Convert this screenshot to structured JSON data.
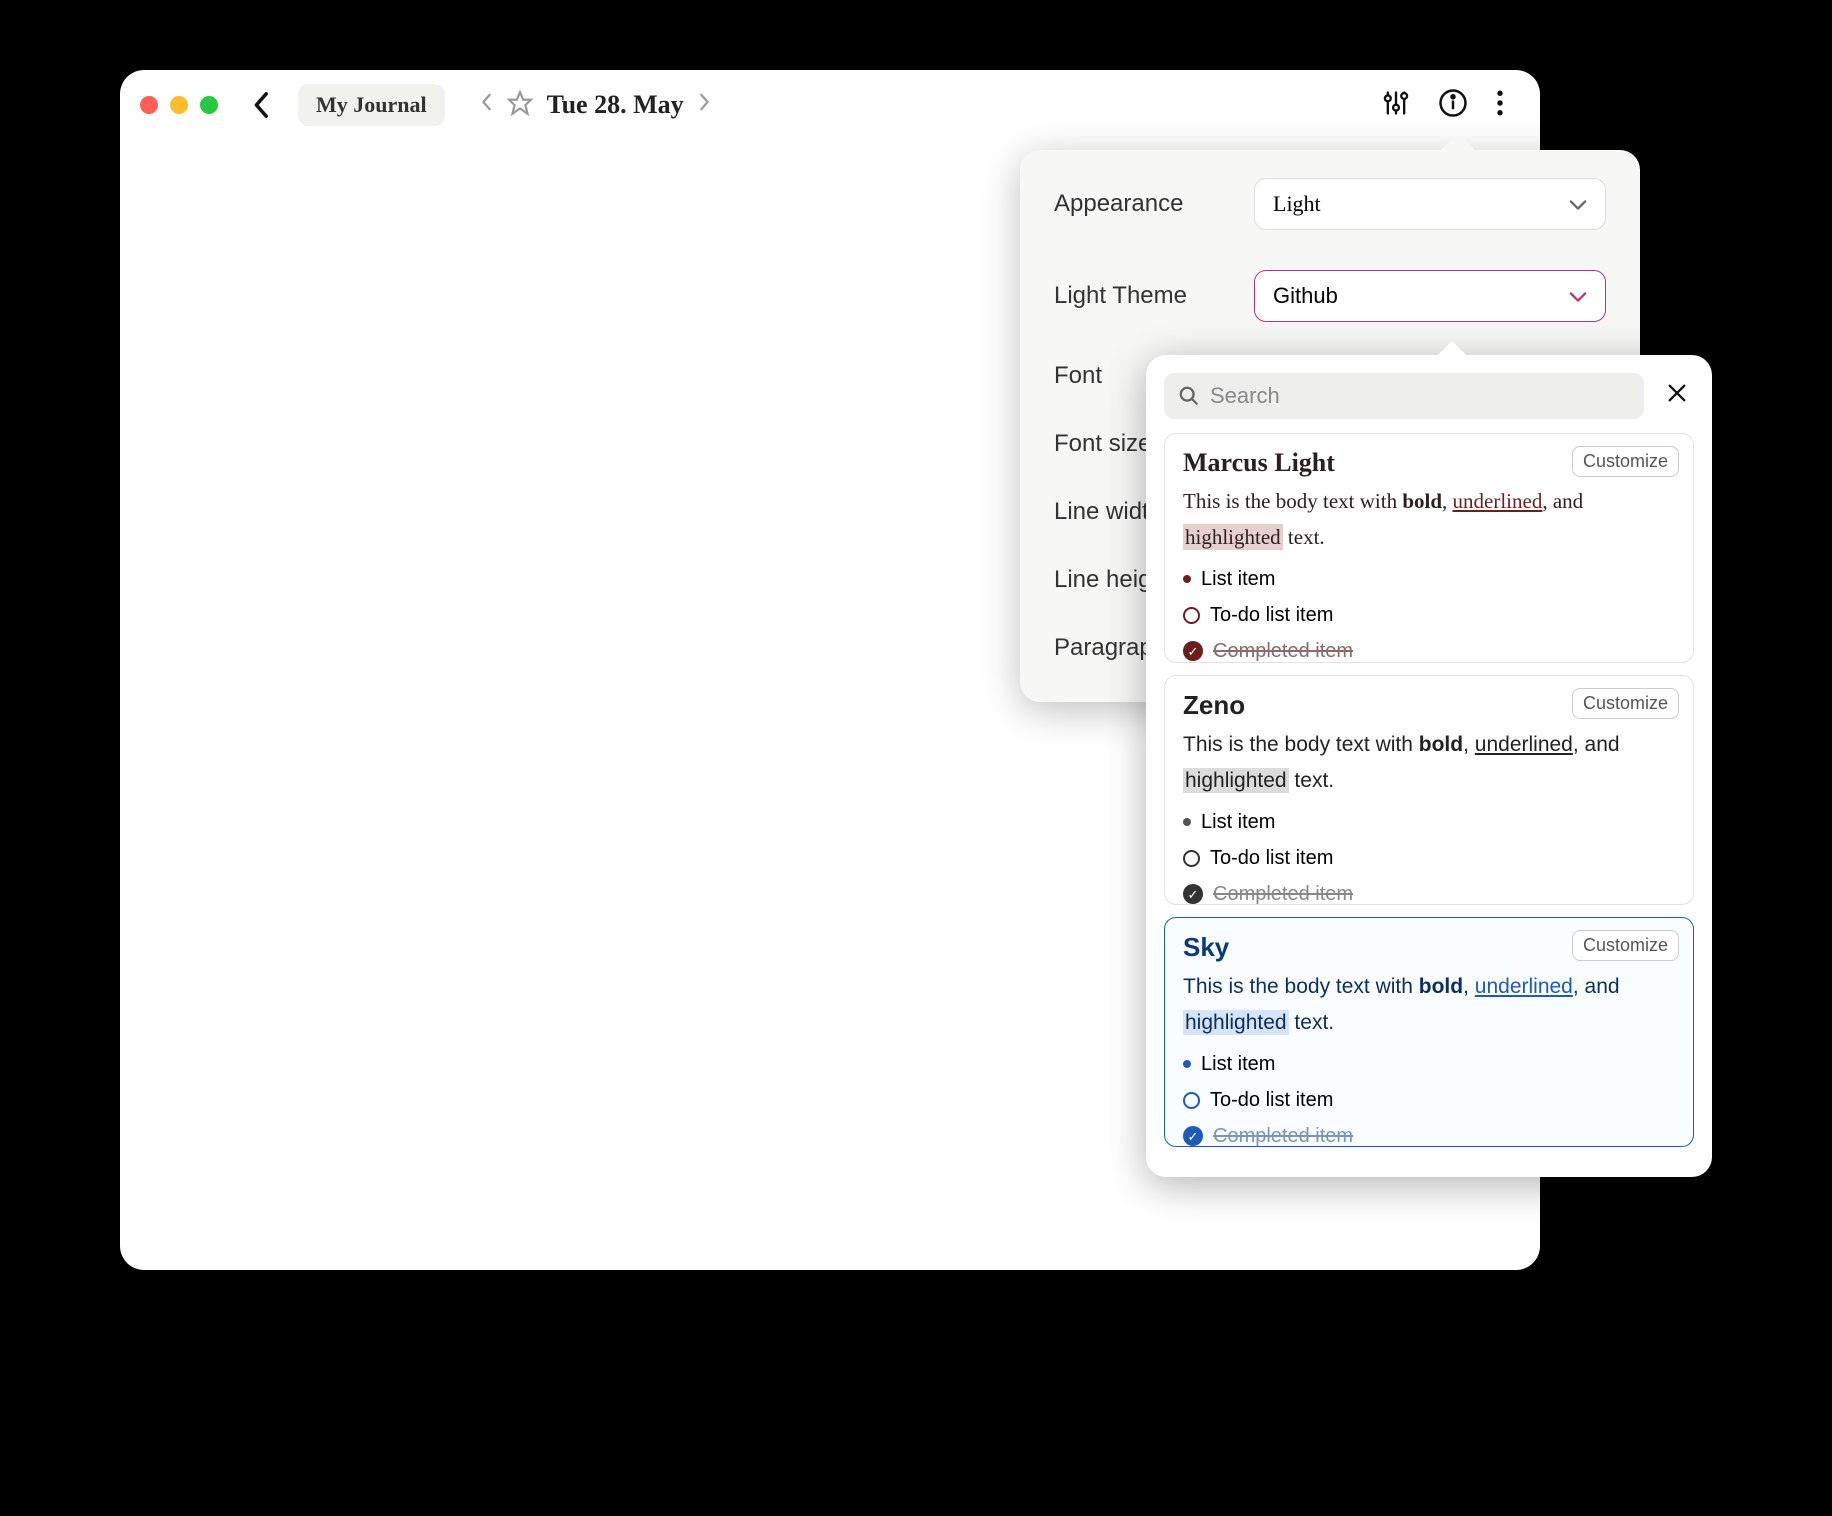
{
  "titlebar": {
    "journal_name": "My Journal",
    "date_title": "Tue 28. May"
  },
  "settings": {
    "appearance": {
      "label": "Appearance",
      "value": "Light"
    },
    "light_theme": {
      "label": "Light Theme",
      "value": "Github"
    },
    "font": {
      "label": "Font"
    },
    "font_size": {
      "label": "Font size"
    },
    "line_width": {
      "label": "Line width"
    },
    "line_height": {
      "label": "Line height"
    },
    "paragraph_spacing": {
      "label": "Paragraph S"
    }
  },
  "theme_picker": {
    "search_placeholder": "Search",
    "customize_label": "Customize",
    "preview": {
      "body_prefix": "This is the body text with ",
      "bold": "bold",
      "underlined": "underlined",
      "and": ", and ",
      "highlighted": "highlighted",
      "suffix": " text.",
      "list_item": "List item",
      "todo_item": "To-do list item",
      "completed_item": "Completed item"
    },
    "themes": [
      {
        "name": "Marcus Light",
        "class": "marcus",
        "selected": false
      },
      {
        "name": "Zeno",
        "class": "zeno",
        "selected": false
      },
      {
        "name": "Sky",
        "class": "sky",
        "selected": true
      }
    ]
  }
}
